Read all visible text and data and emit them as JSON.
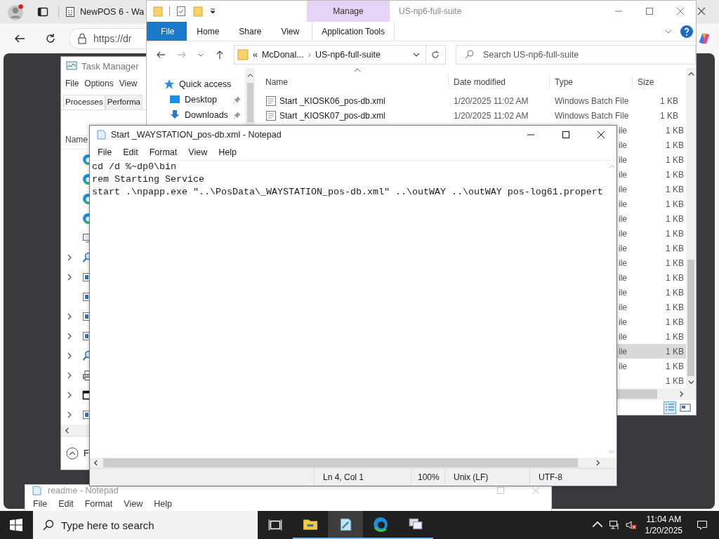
{
  "browser": {
    "tab_title": "NewPOS 6 - Wa",
    "address": "https://dr"
  },
  "task_manager": {
    "title": "Task Manager",
    "menu": [
      "File",
      "Options",
      "View"
    ],
    "tabs": [
      {
        "label": "Processes",
        "selected": true
      },
      {
        "label": "Performa",
        "selected": false
      }
    ],
    "column": "Name",
    "rows": [
      {
        "kind": "edge",
        "expandable": false
      },
      {
        "kind": "edge",
        "expandable": false
      },
      {
        "kind": "edge",
        "expandable": false
      },
      {
        "kind": "edge",
        "expandable": false
      },
      {
        "kind": "monitor",
        "expandable": false
      },
      {
        "kind": "search",
        "expandable": true
      },
      {
        "kind": "app",
        "expandable": true
      },
      {
        "kind": "app",
        "expandable": false
      },
      {
        "kind": "app",
        "expandable": true
      },
      {
        "kind": "app",
        "expandable": true
      },
      {
        "kind": "search",
        "expandable": true
      },
      {
        "kind": "printer",
        "expandable": true
      },
      {
        "kind": "window",
        "expandable": true
      },
      {
        "kind": "app",
        "expandable": true
      }
    ],
    "footer": "F"
  },
  "explorer": {
    "title": "US-np6-full-suite",
    "context_tab": "Manage",
    "ribbon_tabs": [
      {
        "label": "File",
        "kind": "file"
      },
      {
        "label": "Home",
        "kind": "plain"
      },
      {
        "label": "Share",
        "kind": "plain"
      },
      {
        "label": "View",
        "kind": "plain"
      },
      {
        "label": "Application Tools",
        "kind": "context"
      }
    ],
    "path_overflow": "«",
    "path_separator": "›",
    "path": [
      "McDonal...",
      "US-np6-full-suite"
    ],
    "search": {
      "placeholder": "Search US-np6-full-suite"
    },
    "nav": [
      {
        "label": "Quick access",
        "kind": "star",
        "pinned": false
      },
      {
        "label": "Desktop",
        "kind": "desktop",
        "pinned": true
      },
      {
        "label": "Downloads",
        "kind": "download",
        "pinned": true
      }
    ],
    "columns": [
      "Name",
      "Date modified",
      "Type",
      "Size"
    ],
    "files": [
      {
        "kind": "full",
        "name": "Start _KIOSK06_pos-db.xml",
        "date": "1/20/2025 11:02 AM",
        "type": "Windows Batch File",
        "size": "1 KB",
        "selected": false
      },
      {
        "kind": "full",
        "name": "Start _KIOSK07_pos-db.xml",
        "date": "1/20/2025 11:02 AM",
        "type": "Windows Batch File",
        "size": "1 KB",
        "selected": false
      },
      {
        "kind": "partial",
        "type": "ile",
        "size": "1 KB",
        "selected": false
      },
      {
        "kind": "partial",
        "type": "ile",
        "size": "1 KB",
        "selected": false
      },
      {
        "kind": "partial",
        "type": "ile",
        "size": "1 KB",
        "selected": false
      },
      {
        "kind": "partial",
        "type": "ile",
        "size": "1 KB",
        "selected": false
      },
      {
        "kind": "partial",
        "type": "ile",
        "size": "1 KB",
        "selected": false
      },
      {
        "kind": "partial",
        "type": "ile",
        "size": "1 KB",
        "selected": false
      },
      {
        "kind": "partial",
        "type": "ile",
        "size": "1 KB",
        "selected": false
      },
      {
        "kind": "partial",
        "type": "ile",
        "size": "1 KB",
        "selected": false
      },
      {
        "kind": "partial",
        "type": "ile",
        "size": "1 KB",
        "selected": false
      },
      {
        "kind": "partial",
        "type": "ile",
        "size": "1 KB",
        "selected": false
      },
      {
        "kind": "partial",
        "type": "ile",
        "size": "1 KB",
        "selected": false
      },
      {
        "kind": "partial",
        "type": "ile",
        "size": "1 KB",
        "selected": false
      },
      {
        "kind": "partial",
        "type": "ile",
        "size": "1 KB",
        "selected": false
      },
      {
        "kind": "partial",
        "type": "ile",
        "size": "1 KB",
        "selected": false
      },
      {
        "kind": "partial",
        "type": "ile",
        "size": "1 KB",
        "selected": false
      },
      {
        "kind": "partial",
        "type": "ile",
        "size": "1 KB",
        "selected": true
      },
      {
        "kind": "partial",
        "type": "ile",
        "size": "1 KB",
        "selected": false
      },
      {
        "kind": "partial",
        "size": "1 KB",
        "selected": false
      }
    ]
  },
  "readme": {
    "title": "readme - Notepad",
    "menu": [
      "File",
      "Edit",
      "Format",
      "View",
      "Help"
    ]
  },
  "notepad": {
    "title": "Start _WAYSTATION_pos-db.xml - Notepad",
    "menu": [
      "File",
      "Edit",
      "Format",
      "View",
      "Help"
    ],
    "lines": [
      "cd /d %~dp0\\bin",
      "rem Starting Service",
      "start .\\npapp.exe \"..\\PosData\\_WAYSTATION_pos-db.xml\" ..\\outWAY ..\\outWAY pos-log61.propert"
    ],
    "status": [
      "Ln 4, Col 1",
      "100%",
      "Unix (LF)",
      "UTF-8"
    ]
  },
  "taskbar": {
    "search": {
      "placeholder": "Type here to search"
    },
    "apps": [
      {
        "kind": "task-view",
        "running": false,
        "selected": false
      },
      {
        "kind": "explorer",
        "running": true,
        "selected": false
      },
      {
        "kind": "notepad",
        "running": true,
        "selected": true
      },
      {
        "kind": "edge",
        "running": true,
        "selected": false
      },
      {
        "kind": "remote",
        "running": true,
        "selected": false
      }
    ],
    "time": "11:04 AM",
    "date": "1/20/2025"
  }
}
